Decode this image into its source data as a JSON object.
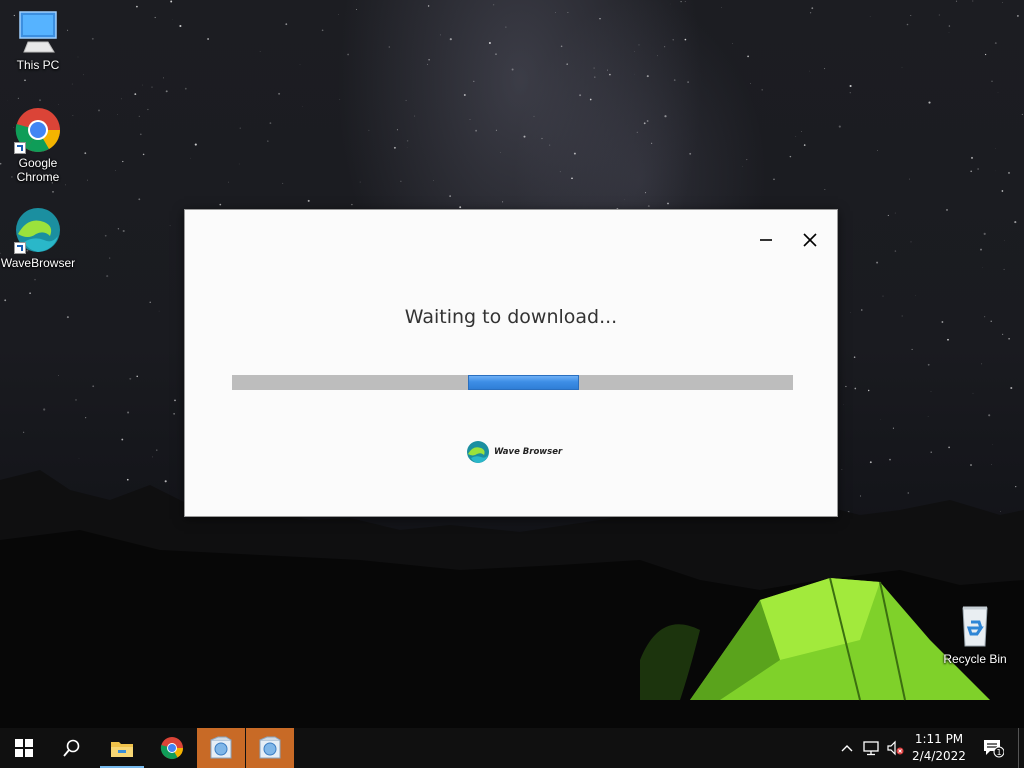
{
  "desktop": {
    "icons": [
      {
        "label": "This PC",
        "icon": "computer-icon"
      },
      {
        "label": "Google Chrome",
        "icon": "chrome-icon"
      },
      {
        "label": "WaveBrowser",
        "icon": "wavebrowser-icon"
      },
      {
        "label": "Recycle Bin",
        "icon": "recycle-bin-icon"
      }
    ]
  },
  "installer": {
    "status": "Waiting to download...",
    "progress_indeterminate": true,
    "brand": "Wave Browser",
    "accent": "#3d8ee6",
    "track_color": "#bdbdbd"
  },
  "taskbar": {
    "items": [
      "start-icon",
      "search-icon",
      "file-explorer-icon",
      "chrome-icon",
      "installer-icon",
      "installer-icon"
    ],
    "clock_time": "1:11 PM",
    "clock_date": "2/4/2022",
    "notification_count": "1"
  }
}
